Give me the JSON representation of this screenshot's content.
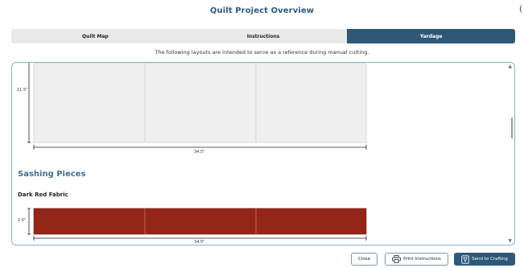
{
  "header": {
    "title": "Quilt Project Overview",
    "corner_glyph": "("
  },
  "tabs": [
    {
      "label": "Quilt Map",
      "active": false
    },
    {
      "label": "Instructions",
      "active": false
    },
    {
      "label": "Yardage",
      "active": true
    }
  ],
  "notice": "The following layouts are intended to serve as a reference during manual cutting.",
  "layouts": {
    "top_block": {
      "height_label": "11.5\"",
      "width_label": "34.5\"",
      "fill_color": "#efefef",
      "segments": 3
    },
    "sashing": {
      "section_title": "Sashing Pieces",
      "fabric_name": "Dark Red Fabric",
      "height_label": "2.5\"",
      "width_label": "34.5\"",
      "fill_color": "#942617",
      "segments": 3
    }
  },
  "footer": {
    "close_label": "Close",
    "print_label": "Print Instructions",
    "send_label": "Send to Crafting"
  },
  "icons": {
    "print": "printer-icon",
    "send": "send-to-machine-icon"
  },
  "colors": {
    "accent": "#2e5877",
    "title": "#2d5b80",
    "panel_border": "#8bb0cb"
  }
}
